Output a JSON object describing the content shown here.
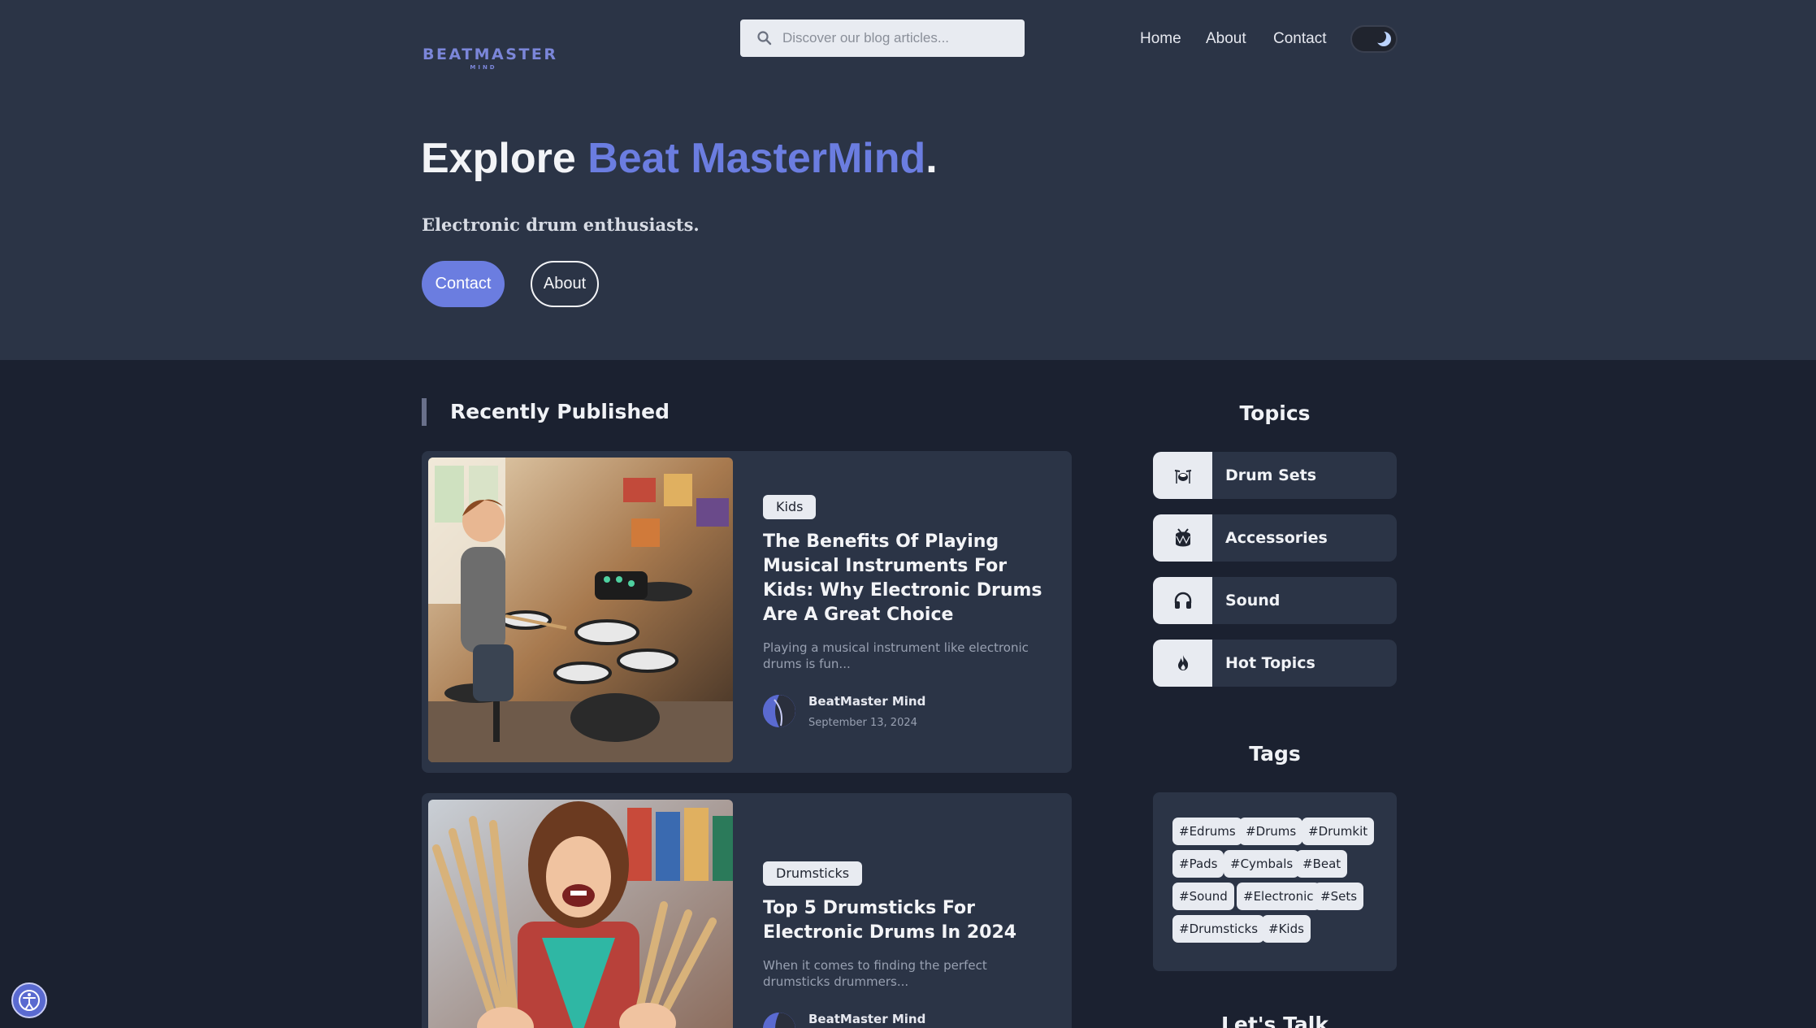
{
  "header": {
    "logo_text": "BEATMASTER",
    "logo_sub": "MIND",
    "search_placeholder": "Discover our blog articles...",
    "nav": [
      "Home",
      "About",
      "Contact"
    ]
  },
  "hero": {
    "title_prefix": "Explore ",
    "title_brand": "Beat MasterMind",
    "title_suffix": ".",
    "tagline": "Electronic drum enthusiasts.",
    "primary_button": "Contact",
    "secondary_button": "About"
  },
  "recent": {
    "section_title": "Recently Published",
    "posts": [
      {
        "category": "Kids",
        "title": "The Benefits Of Playing Musical Instruments For Kids: Why Electronic Drums Are A Great Choice",
        "excerpt": "Playing a musical instrument like electronic drums is fun...",
        "author": "BeatMaster Mind",
        "date": "September 13, 2024"
      },
      {
        "category": "Drumsticks",
        "title": "Top 5 Drumsticks For Electronic Drums In 2024",
        "excerpt": "When it comes to finding the perfect drumsticks drummers...",
        "author": "BeatMaster Mind"
      }
    ]
  },
  "sidebar": {
    "topics_title": "Topics",
    "topics": [
      {
        "label": "Drum Sets",
        "icon": "drum-set-icon"
      },
      {
        "label": "Accessories",
        "icon": "drum-icon"
      },
      {
        "label": "Sound",
        "icon": "headphones-icon"
      },
      {
        "label": "Hot Topics",
        "icon": "fire-icon"
      }
    ],
    "tags_title": "Tags",
    "tags": [
      "#Edrums",
      "#Drums",
      "#Drumkit",
      "#Pads",
      "#Cymbals",
      "#Beat",
      "#Sound",
      "#Electronic",
      "#Sets",
      "#Drumsticks",
      "#Kids"
    ],
    "lets_talk_title": "Let's Talk"
  },
  "colors": {
    "accent": "#6b7de0",
    "hero_bg": "#2b3446",
    "page_bg": "#1b2130"
  }
}
